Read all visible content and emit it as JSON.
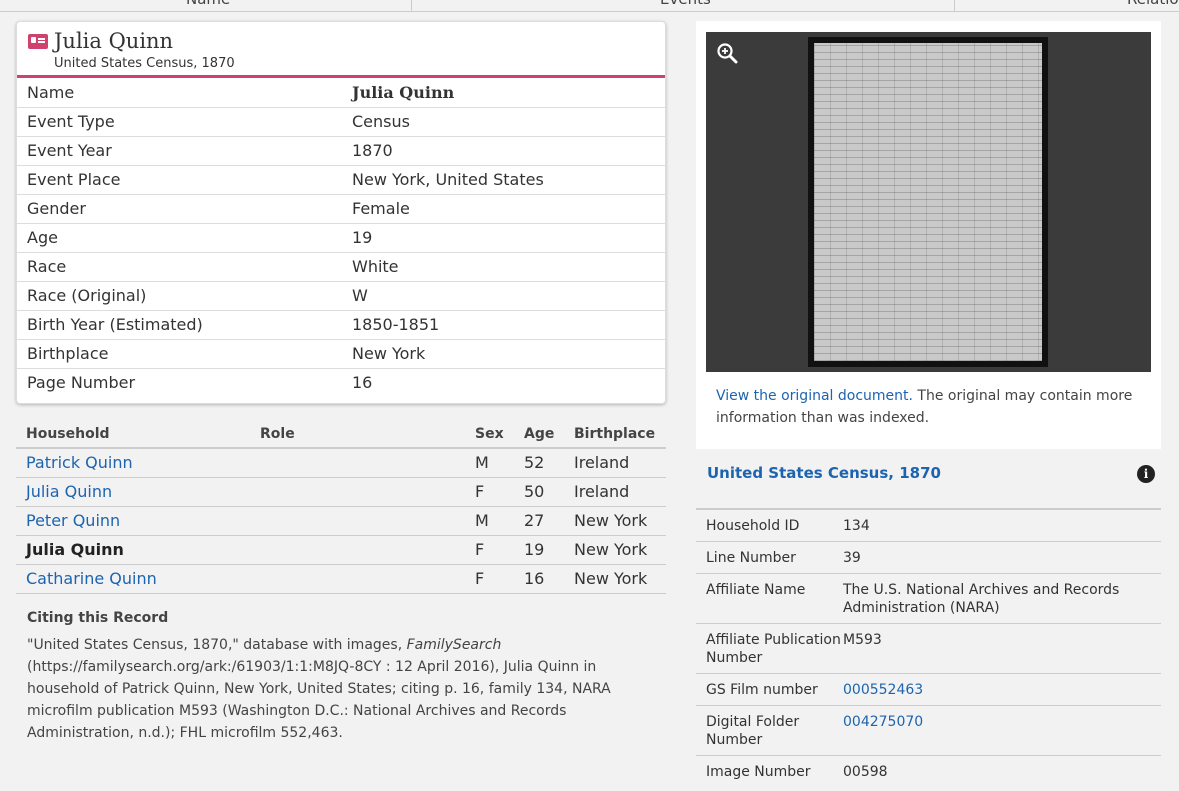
{
  "topbar": {
    "tabs": [
      "Name",
      "Events",
      "Relation"
    ]
  },
  "record": {
    "title": "Julia Quinn",
    "subtitle": "United States Census, 1870",
    "facts": [
      {
        "label": "Name",
        "value": "Julia Quinn"
      },
      {
        "label": "Event Type",
        "value": "Census"
      },
      {
        "label": "Event Year",
        "value": "1870"
      },
      {
        "label": "Event Place",
        "value": "New York, United States"
      },
      {
        "label": "Gender",
        "value": "Female"
      },
      {
        "label": "Age",
        "value": "19"
      },
      {
        "label": "Race",
        "value": "White"
      },
      {
        "label": "Race (Original)",
        "value": "W"
      },
      {
        "label": "Birth Year (Estimated)",
        "value": "1850-1851"
      },
      {
        "label": "Birthplace",
        "value": "New York"
      },
      {
        "label": "Page Number",
        "value": "16"
      }
    ]
  },
  "household": {
    "headers": {
      "household": "Household",
      "role": "Role",
      "sex": "Sex",
      "age": "Age",
      "birthplace": "Birthplace"
    },
    "rows": [
      {
        "name": "Patrick Quinn",
        "role": "",
        "sex": "M",
        "age": "52",
        "birthplace": "Ireland"
      },
      {
        "name": "Julia Quinn",
        "role": "",
        "sex": "F",
        "age": "50",
        "birthplace": "Ireland"
      },
      {
        "name": "Peter Quinn",
        "role": "",
        "sex": "M",
        "age": "27",
        "birthplace": "New York"
      },
      {
        "name": "Julia Quinn",
        "role": "",
        "sex": "F",
        "age": "19",
        "birthplace": "New York"
      },
      {
        "name": "Catharine Quinn",
        "role": "",
        "sex": "F",
        "age": "16",
        "birthplace": "New York"
      }
    ]
  },
  "citing": {
    "heading": "Citing this Record",
    "part1": "\"United States Census, 1870,\" database with images, ",
    "italic": "FamilySearch",
    "part2": " (https://familysearch.org/ark:/61903/1:1:M8JQ-8CY : 12 April 2016), Julia Quinn in household of Patrick Quinn, New York, United States; citing p. 16, family 134, NARA microfilm publication M593 (Washington D.C.: National Archives and Records Administration, n.d.); FHL microfilm 552,463."
  },
  "document": {
    "link_text": "View the original document.",
    "note": " The original may contain more information than was indexed."
  },
  "source": {
    "title": "United States Census, 1870",
    "rows": [
      {
        "label": "Household ID",
        "value": "134",
        "link": false
      },
      {
        "label": "Line Number",
        "value": "39",
        "link": false
      },
      {
        "label": "Affiliate Name",
        "value": "The U.S. National Archives and Records Administration (NARA)",
        "link": false
      },
      {
        "label": "Affiliate Publication Number",
        "value": "M593",
        "link": false
      },
      {
        "label": "GS Film number",
        "value": "000552463",
        "link": true
      },
      {
        "label": "Digital Folder Number",
        "value": "004275070",
        "link": true
      },
      {
        "label": "Image Number",
        "value": "00598",
        "link": false
      }
    ]
  },
  "colors": {
    "accent": "#d0426e",
    "link": "#1d64b0"
  }
}
